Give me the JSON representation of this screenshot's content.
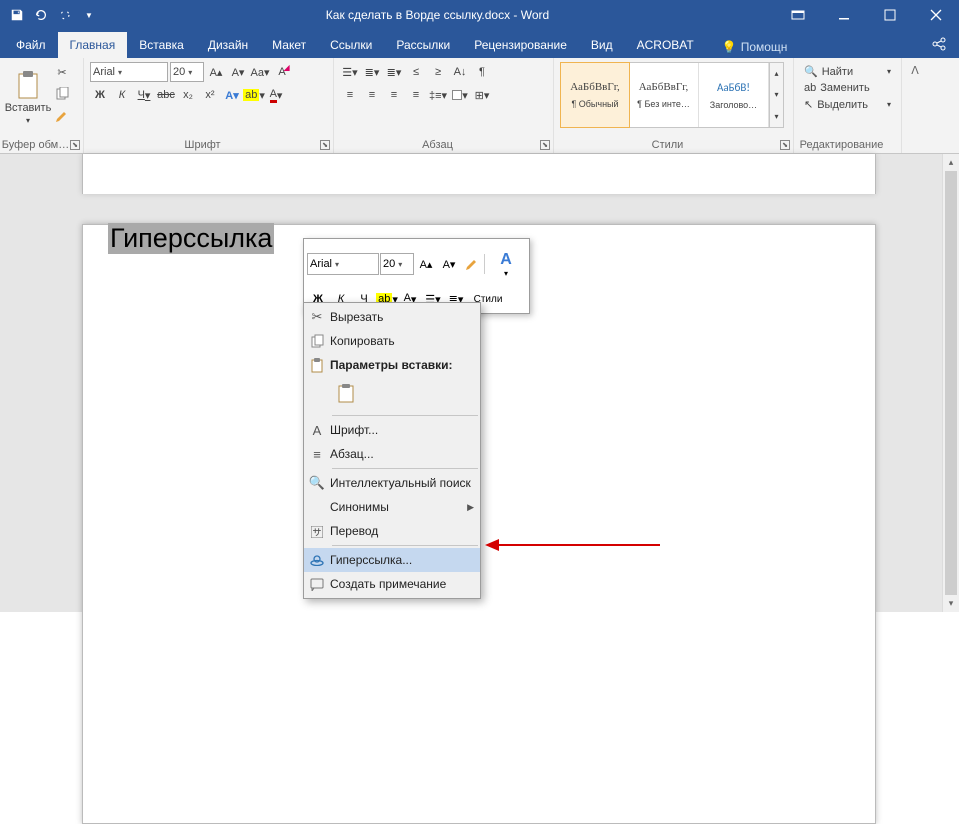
{
  "titlebar": {
    "title": "Как сделать в Ворде ссылку.docx - Word"
  },
  "tabs": {
    "file": "Файл",
    "home": "Главная",
    "insert": "Вставка",
    "design": "Дизайн",
    "layout": "Макет",
    "references": "Ссылки",
    "mailings": "Рассылки",
    "review": "Рецензирование",
    "view": "Вид",
    "acrobat": "ACROBAT",
    "help": "Помощн"
  },
  "ribbon": {
    "clipboard": {
      "paste": "Вставить",
      "label": "Буфер обм…"
    },
    "font": {
      "label": "Шрифт",
      "name": "Arial",
      "size": "20",
      "bold": "Ж",
      "italic": "К",
      "underline": "Ч",
      "strike": "abc",
      "sub": "x₂",
      "sup": "x²"
    },
    "paragraph": {
      "label": "Абзац"
    },
    "styles": {
      "label": "Стили",
      "items": [
        {
          "preview": "АаБбВвГг,",
          "name": "¶ Обычный"
        },
        {
          "preview": "АаБбВвГг,",
          "name": "¶ Без инте…"
        },
        {
          "preview": "АаБбВ!",
          "name": "Заголово…"
        }
      ]
    },
    "editing": {
      "label": "Редактирование",
      "find": "Найти",
      "replace": "Заменить",
      "select": "Выделить"
    }
  },
  "document": {
    "selected_text": "Гиперссылка"
  },
  "minitoolbar": {
    "font": "Arial",
    "size": "20",
    "styles_label": "Стили"
  },
  "context_menu": {
    "cut": "Вырезать",
    "copy": "Копировать",
    "paste_header": "Параметры вставки:",
    "font": "Шрифт...",
    "paragraph": "Абзац...",
    "smart_lookup": "Интеллектуальный поиск",
    "synonyms": "Синонимы",
    "translate": "Перевод",
    "hyperlink": "Гиперссылка...",
    "new_comment": "Создать примечание"
  }
}
